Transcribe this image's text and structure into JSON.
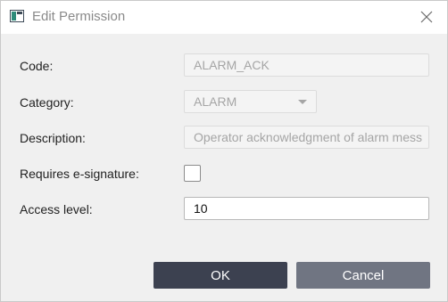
{
  "window": {
    "title": "Edit Permission",
    "app_icon": "window-app-icon",
    "close_icon": "close-icon"
  },
  "form": {
    "code": {
      "label": "Code:",
      "value": "ALARM_ACK"
    },
    "category": {
      "label": "Category:",
      "value": "ALARM"
    },
    "description": {
      "label": "Description:",
      "value": "Operator acknowledgment of alarm mess"
    },
    "requires_esignature": {
      "label": "Requires e-signature:",
      "checked": false
    },
    "access_level": {
      "label": "Access level:",
      "value": "10"
    }
  },
  "buttons": {
    "ok_label": "OK",
    "cancel_label": "Cancel"
  },
  "colors": {
    "ok_button": "#3c4150",
    "cancel_button": "#707582",
    "dialog_background": "#f0f0f0"
  }
}
